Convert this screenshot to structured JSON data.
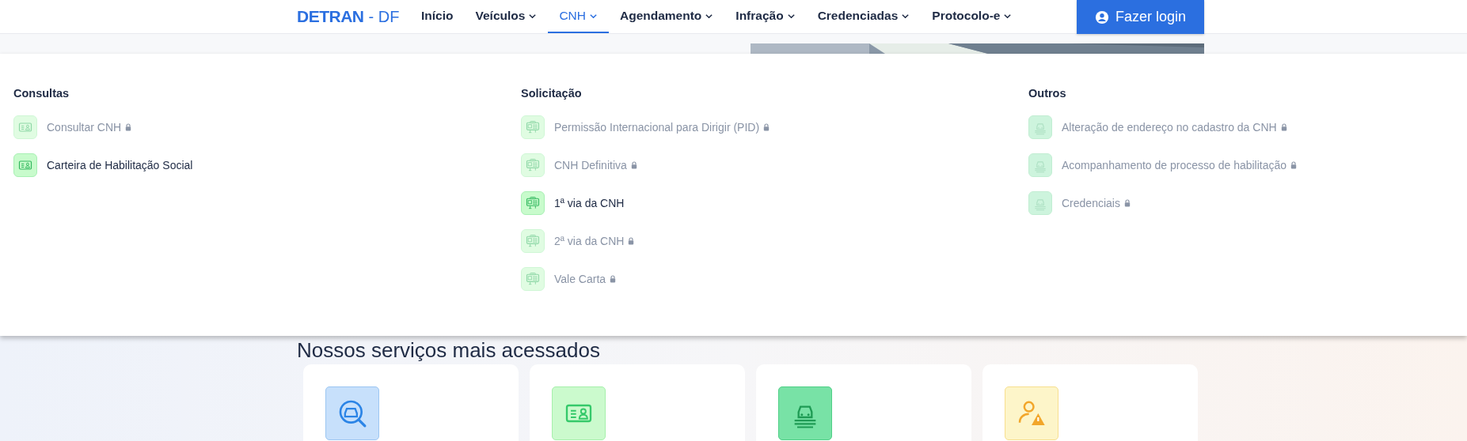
{
  "logo": {
    "name": "DETRAN",
    "suffix": "- DF"
  },
  "nav": [
    {
      "label": "Início",
      "dropdown": false,
      "selected": false
    },
    {
      "label": "Veículos",
      "dropdown": true,
      "selected": false
    },
    {
      "label": "CNH",
      "dropdown": true,
      "selected": true
    },
    {
      "label": "Agendamento",
      "dropdown": true,
      "selected": false
    },
    {
      "label": "Infração",
      "dropdown": true,
      "selected": false
    },
    {
      "label": "Credenciadas",
      "dropdown": true,
      "selected": false
    },
    {
      "label": "Protocolo-e",
      "dropdown": true,
      "selected": false
    }
  ],
  "login_button": {
    "label": "Fazer login"
  },
  "dropdown": {
    "columns": [
      {
        "title": "Consultas",
        "items": [
          {
            "label": "Consultar CNH",
            "kind": "id-card",
            "locked": true
          },
          {
            "label": "Carteira de Habilitação Social",
            "kind": "id-card",
            "locked": false
          }
        ]
      },
      {
        "title": "Solicitação",
        "items": [
          {
            "label": "Permissão Internacional para Dirigir (PID)",
            "kind": "document",
            "locked": true
          },
          {
            "label": "CNH Definitiva",
            "kind": "document",
            "locked": true
          },
          {
            "label": "1ª via da CNH",
            "kind": "document",
            "locked": false
          },
          {
            "label": "2ª via da CNH",
            "kind": "document",
            "locked": true
          },
          {
            "label": "Vale Carta",
            "kind": "document",
            "locked": true
          }
        ]
      },
      {
        "title": "Outros",
        "items": [
          {
            "label": "Alteração de endereço no cadastro da CNH",
            "kind": "car-doc",
            "locked": true
          },
          {
            "label": "Acompanhamento de processo de habilitação",
            "kind": "car-doc",
            "locked": true
          },
          {
            "label": "Credenciais",
            "kind": "car-doc",
            "locked": true
          }
        ]
      }
    ]
  },
  "services": {
    "title": "Nossos serviços mais acessados",
    "cards": [
      {
        "kind": "car-search"
      },
      {
        "kind": "id-card"
      },
      {
        "kind": "car-doc"
      },
      {
        "kind": "user-warning"
      }
    ]
  }
}
